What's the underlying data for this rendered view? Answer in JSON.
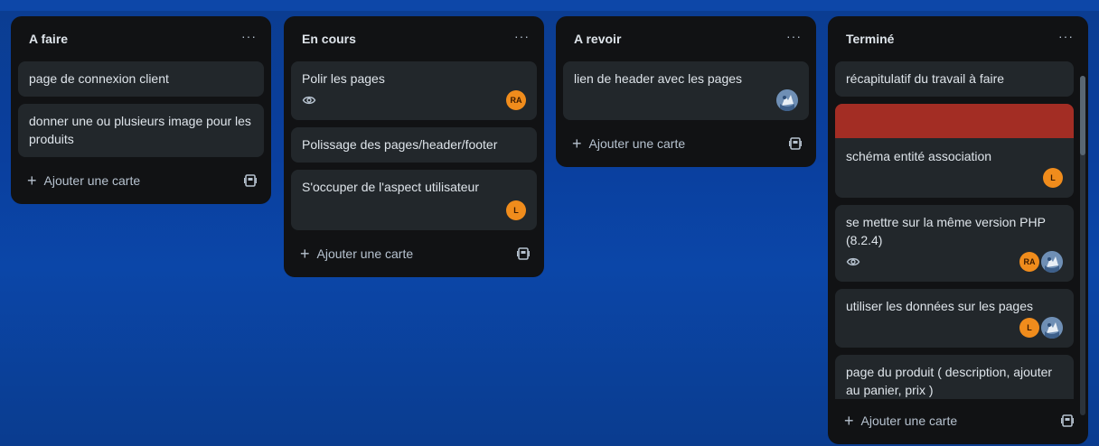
{
  "board": {
    "lists": [
      {
        "title": "A faire",
        "menu": "···",
        "cards": [
          {
            "text": "page de connexion client"
          },
          {
            "text": "donner une ou plusieurs image pour les produits"
          }
        ],
        "add_label": "Ajouter une carte"
      },
      {
        "title": "En cours",
        "menu": "···",
        "cards": [
          {
            "text": "Polir les pages",
            "watching": true,
            "avatars": [
              "RA"
            ]
          },
          {
            "text": "Polissage des pages/header/footer"
          },
          {
            "text": "S'occuper de l'aspect utilisateur",
            "avatars": [
              "L"
            ]
          }
        ],
        "add_label": "Ajouter une carte"
      },
      {
        "title": "A revoir",
        "menu": "···",
        "cards": [
          {
            "text": "lien de header avec les pages",
            "avatars": [
              "photo"
            ]
          }
        ],
        "add_label": "Ajouter une carte"
      },
      {
        "title": "Terminé",
        "menu": "···",
        "cards": [
          {
            "text": "récapitulatif du travail à faire"
          },
          {
            "text": "schéma entité association",
            "cover_color": "#a32d24",
            "avatars": [
              "L"
            ]
          },
          {
            "text": "se mettre sur la même version PHP (8.2.4)",
            "watching": true,
            "avatars": [
              "RA",
              "photo"
            ]
          },
          {
            "text": "utiliser les données sur les pages",
            "avatars": [
              "L",
              "photo"
            ]
          },
          {
            "text": "page du produit ( description, ajouter au panier, prix )"
          }
        ],
        "add_label": "Ajouter une carte"
      }
    ]
  },
  "icons": {
    "menu": "more-icon",
    "add": "plus-icon",
    "template": "template-icon",
    "watch": "eye-icon"
  },
  "colors": {
    "list_bg": "#111214",
    "card_bg": "#22272b",
    "avatar_orange": "#f08c1c",
    "cover_red": "#a32d24"
  }
}
